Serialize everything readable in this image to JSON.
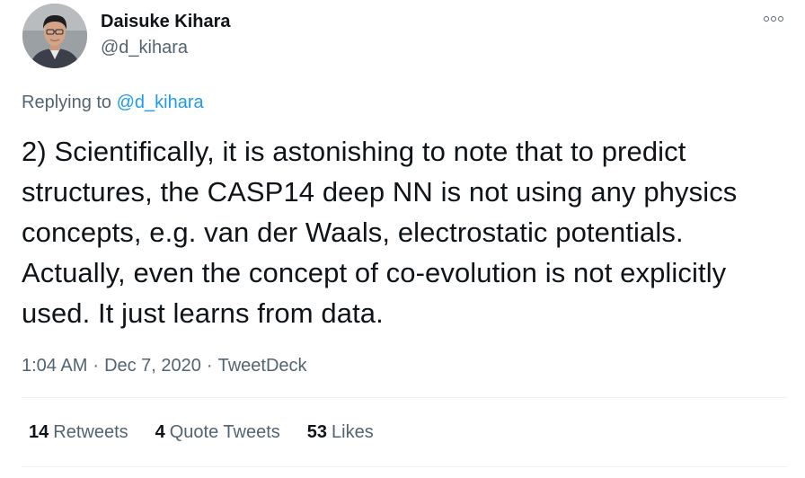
{
  "author": {
    "display_name": "Daisuke Kihara",
    "handle": "@d_kihara"
  },
  "reply_context": {
    "prefix": "Replying to",
    "mention": "@d_kihara"
  },
  "tweet": {
    "text": "2) Scientifically, it is astonishing to note that to predict structures, the CASP14 deep NN is not using any physics concepts, e.g. van der Waals, electrostatic potentials. Actually, even the concept of co-evolution is not explicitly used. It just learns from data."
  },
  "meta": {
    "time": "1:04 AM",
    "separator": "·",
    "date": "Dec 7, 2020",
    "source": "TweetDeck"
  },
  "stats": {
    "retweets_count": "14",
    "retweets_label": "Retweets",
    "quotes_count": "4",
    "quotes_label": "Quote Tweets",
    "likes_count": "53",
    "likes_label": "Likes"
  },
  "colors": {
    "text_primary": "#0f1419",
    "text_secondary": "#536471",
    "link": "#1d9bf0",
    "divider": "#eff3f4"
  },
  "icons": {
    "more": "more-icon"
  }
}
